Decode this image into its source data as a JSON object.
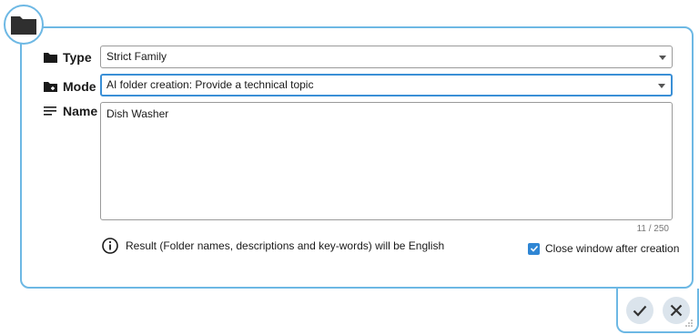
{
  "form": {
    "type": {
      "label": "Type",
      "value": "Strict Family"
    },
    "mode": {
      "label": "Mode",
      "value": "AI folder creation: Provide a technical topic"
    },
    "name": {
      "label": "Name",
      "value": "Dish Washer",
      "counter": "11 / 250"
    }
  },
  "info_text": "Result (Folder names, descriptions and key-words) will be English",
  "close_window": {
    "label": "Close window after creation",
    "checked": true
  },
  "colors": {
    "accent": "#6db8e4",
    "focus": "#3a8fd6",
    "checkbox": "#2f86d4",
    "button_bg": "#dbe4ec"
  },
  "icons": [
    "folder-icon",
    "folder-add-icon",
    "lines-icon",
    "info-icon",
    "check-icon",
    "close-icon"
  ]
}
